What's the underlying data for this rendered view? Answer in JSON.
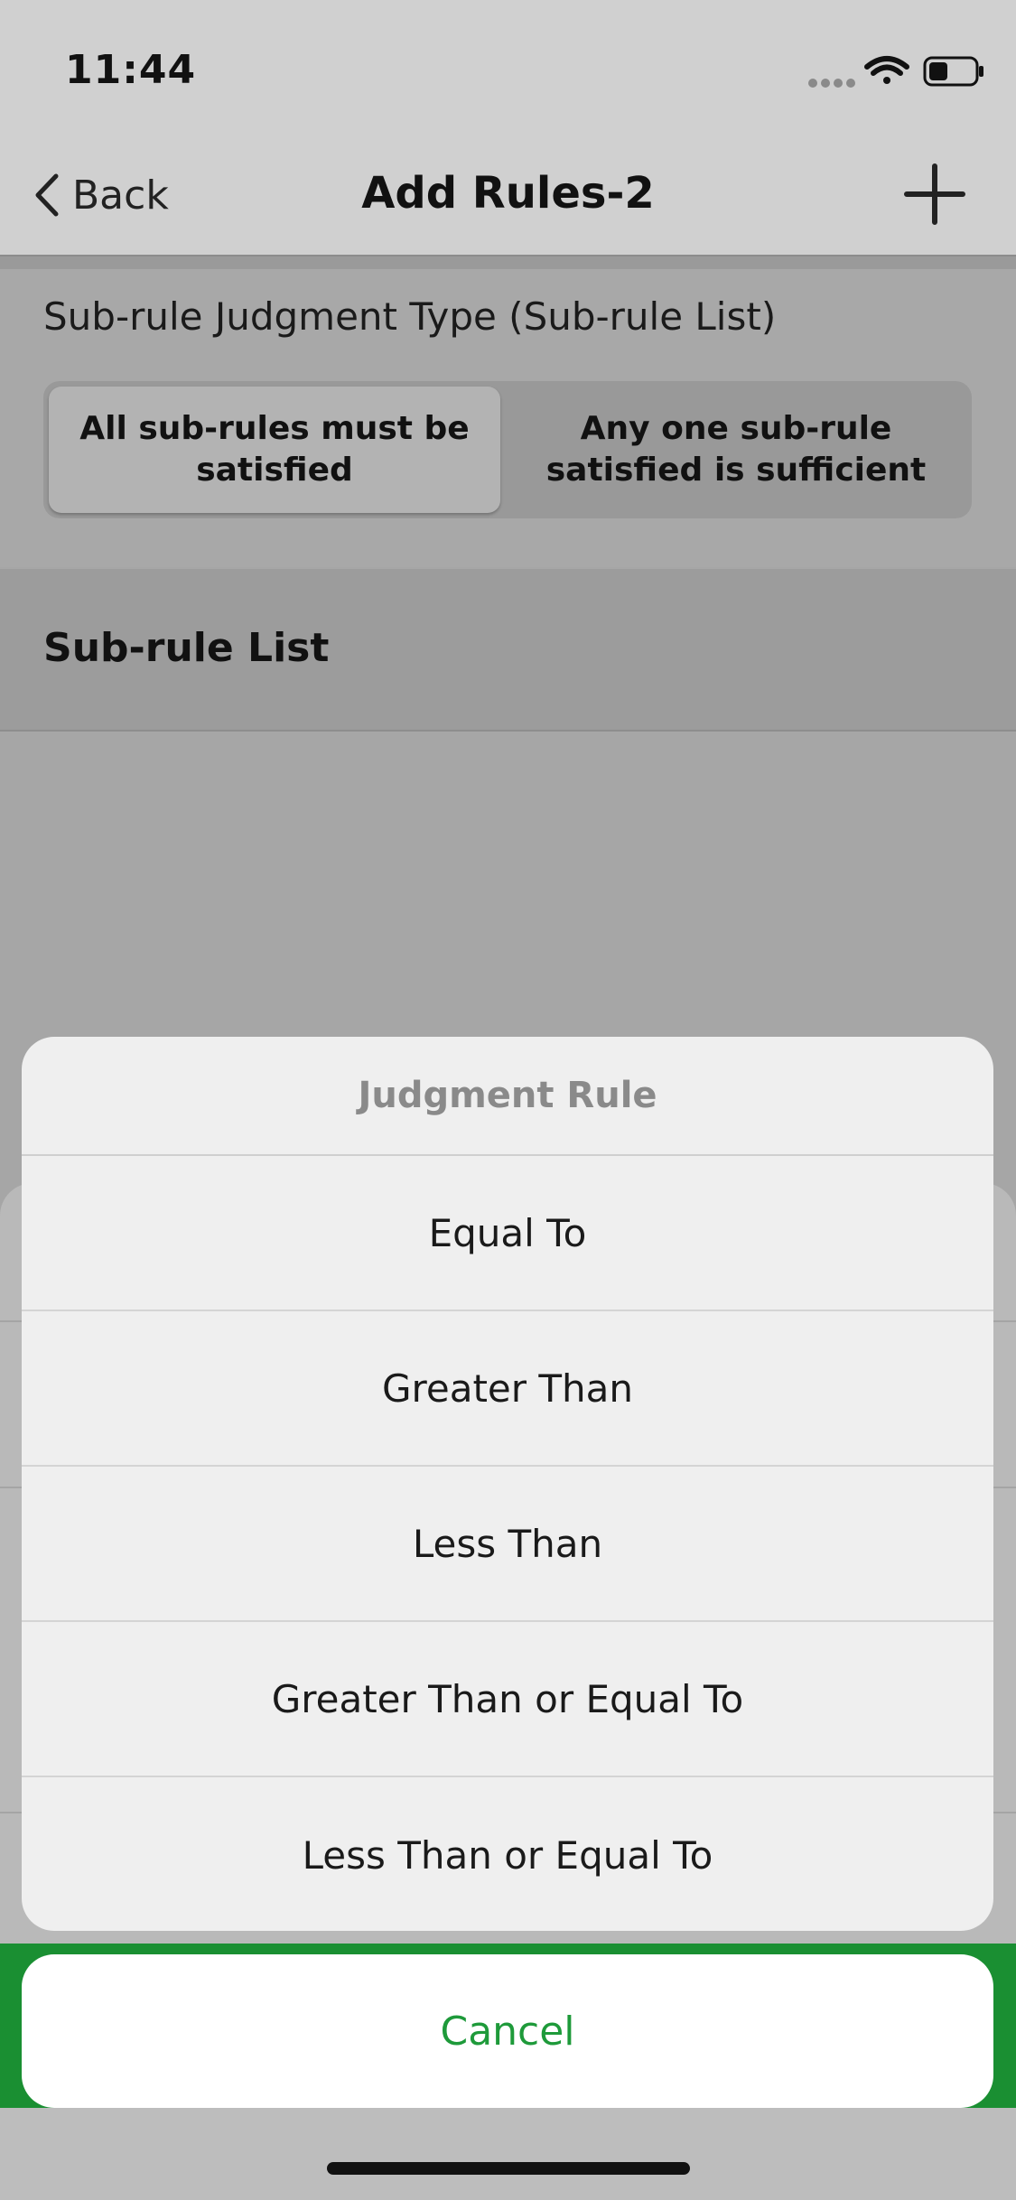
{
  "status_bar": {
    "time": "11:44",
    "icons": [
      "signal-dots-icon",
      "wifi-icon",
      "battery-icon"
    ]
  },
  "nav": {
    "back_label": "Back",
    "title": "Add Rules-2",
    "add_icon": "plus-icon"
  },
  "judgment_type": {
    "label": "Sub-rule Judgment Type (Sub-rule List)",
    "options": [
      "All sub-rules must be satisfied",
      "Any one sub-rule satisfied is sufficient"
    ],
    "selected_index": 0
  },
  "subrule_list": {
    "header": "Sub-rule List"
  },
  "action_sheet": {
    "title": "Judgment Rule",
    "options": [
      "Equal To",
      "Greater Than",
      "Less Than",
      "Greater Than or Equal To",
      "Less Than or Equal To"
    ],
    "cancel_label": "Cancel"
  },
  "colors": {
    "accent_green": "#1e9a3a",
    "bar_green": "#1a8f32"
  }
}
